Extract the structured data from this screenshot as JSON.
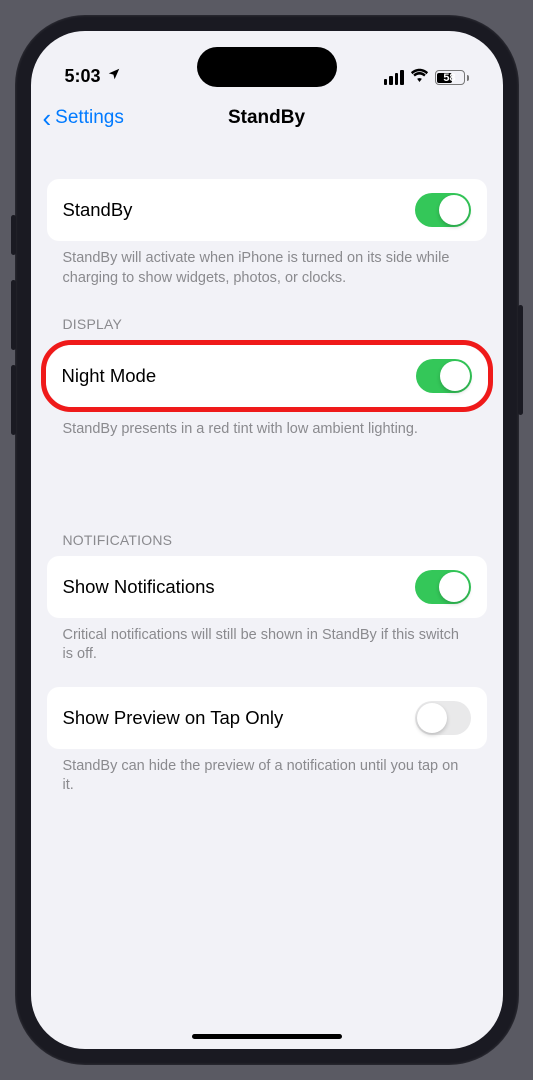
{
  "status": {
    "time": "5:03",
    "battery_percent": "58"
  },
  "nav": {
    "back_label": "Settings",
    "title": "StandBy"
  },
  "sections": {
    "standby": {
      "label": "StandBy",
      "enabled": true,
      "footer": "StandBy will activate when iPhone is turned on its side while charging to show widgets, photos, or clocks."
    },
    "display": {
      "header": "DISPLAY",
      "night_mode": {
        "label": "Night Mode",
        "enabled": true
      },
      "footer": "StandBy presents in a red tint with low ambient lighting."
    },
    "notifications": {
      "header": "NOTIFICATIONS",
      "show_notifications": {
        "label": "Show Notifications",
        "enabled": true
      },
      "show_footer": "Critical notifications will still be shown in StandBy if this switch is off.",
      "preview": {
        "label": "Show Preview on Tap Only",
        "enabled": false
      },
      "preview_footer": "StandBy can hide the preview of a notification until you tap on it."
    }
  }
}
